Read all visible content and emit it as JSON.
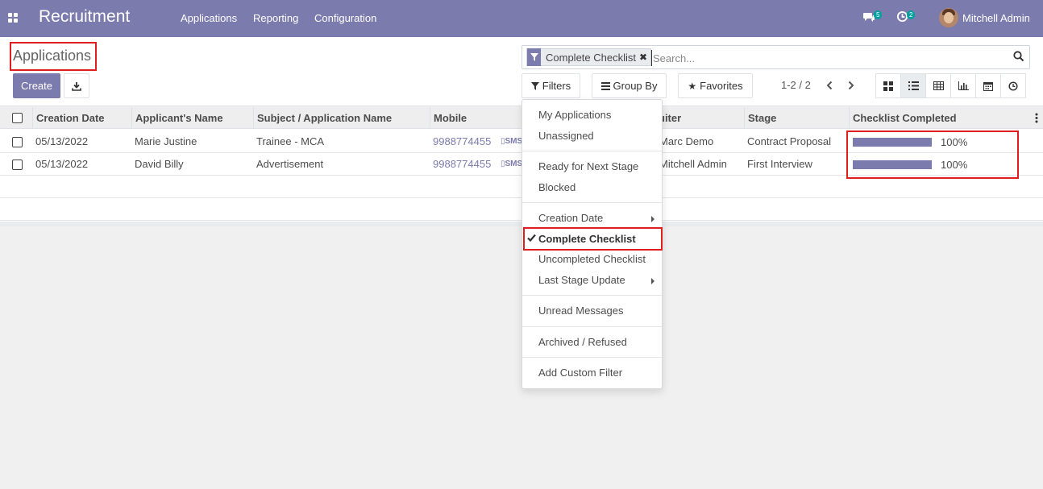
{
  "navbar": {
    "brand": "Recruitment",
    "menu": [
      "Applications",
      "Reporting",
      "Configuration"
    ],
    "messages_count": "5",
    "activities_count": "2",
    "user_name": "Mitchell Admin"
  },
  "control_panel": {
    "title": "Applications",
    "create_label": "Create",
    "search": {
      "facet_label": "Complete Checklist",
      "placeholder": "Search..."
    },
    "filters_label": "Filters",
    "group_by_label": "Group By",
    "favorites_label": "Favorites",
    "pager": "1-2 / 2"
  },
  "list": {
    "columns": [
      "Creation Date",
      "Applicant's Name",
      "Subject / Application Name",
      "Mobile",
      "uiter",
      "Stage",
      "Checklist Completed"
    ],
    "rows": [
      {
        "date": "05/13/2022",
        "name": "Marie Justine",
        "subject": "Trainee - MCA",
        "mobile": "9988774455",
        "sms": "SMS",
        "recruiter": "Marc Demo",
        "stage": "Contract Proposal",
        "progress_text": "100%",
        "progress": 1.0
      },
      {
        "date": "05/13/2022",
        "name": "David Billy",
        "subject": "Advertisement",
        "mobile": "9988774455",
        "sms": "SMS",
        "recruiter": "Mitchell Admin",
        "stage": "First Interview",
        "progress_text": "100%",
        "progress": 1.0
      }
    ]
  },
  "filters_dropdown": {
    "items": [
      "My Applications",
      "Unassigned",
      "Ready for Next Stage",
      "Blocked",
      "Creation Date",
      "Complete Checklist",
      "Uncompleted Checklist",
      "Last Stage Update",
      "Unread Messages",
      "Archived / Refused",
      "Add Custom Filter"
    ],
    "selected": "Complete Checklist"
  },
  "colors": {
    "brand": "#7c7bad",
    "highlight_box": "#e01e1e",
    "badge": "#00a09d"
  }
}
